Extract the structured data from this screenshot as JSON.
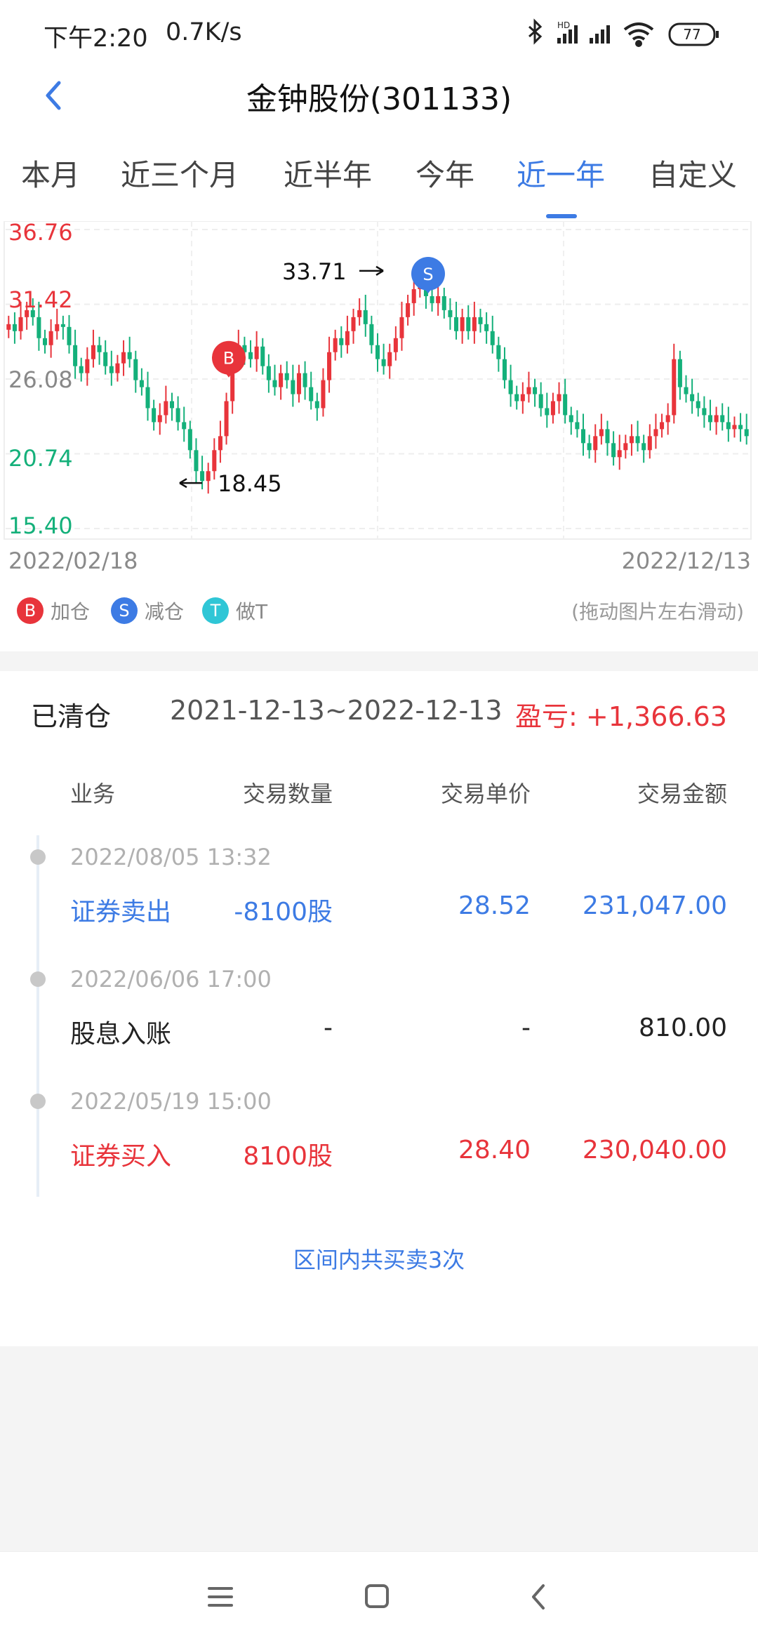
{
  "status_bar": {
    "time": "下午2:20",
    "speed": "0.7K/s",
    "battery": "77"
  },
  "header": {
    "title": "金钟股份(301133)"
  },
  "tabs": [
    {
      "label": "本月",
      "active": false
    },
    {
      "label": "近三个月",
      "active": false
    },
    {
      "label": "近半年",
      "active": false
    },
    {
      "label": "今年",
      "active": false
    },
    {
      "label": "近一年",
      "active": true
    },
    {
      "label": "自定义",
      "active": false
    }
  ],
  "chart": {
    "y_ticks": [
      "36.76",
      "31.42",
      "26.08",
      "20.74",
      "15.40"
    ],
    "start_date": "2022/02/18",
    "end_date": "2022/12/13",
    "high_label": "33.71",
    "low_label": "18.45",
    "buy_marker": "B",
    "sell_marker": "S"
  },
  "chart_data": {
    "type": "candlestick",
    "ylim": [
      15.4,
      36.76
    ],
    "y_ticks": [
      36.76,
      31.42,
      26.08,
      20.74,
      15.4
    ],
    "x_range": [
      "2022/02/18",
      "2022/12/13"
    ],
    "close": [
      30.0,
      29.5,
      30.5,
      31.0,
      30.5,
      29.0,
      28.5,
      29.5,
      30.0,
      29.8,
      28.5,
      27.0,
      26.5,
      27.5,
      28.5,
      28.0,
      27.0,
      26.5,
      27.2,
      28.0,
      27.5,
      26.0,
      25.5,
      24.0,
      23.0,
      23.5,
      24.5,
      24.0,
      23.0,
      22.5,
      21.0,
      19.5,
      18.8,
      19.5,
      21.0,
      22.0,
      24.5,
      27.5,
      28.5,
      28.0,
      27.5,
      28.4,
      27.0,
      26.0,
      25.5,
      26.5,
      26.0,
      25.0,
      26.5,
      25.5,
      24.5,
      24.0,
      26.0,
      28.0,
      29.0,
      28.5,
      29.5,
      30.5,
      31.0,
      30.0,
      28.5,
      27.5,
      27.0,
      28.0,
      29.0,
      30.5,
      31.5,
      32.5,
      33.0,
      32.0,
      31.5,
      32.0,
      31.0,
      30.5,
      29.5,
      30.5,
      29.5,
      30.5,
      30.0,
      29.5,
      28.5,
      27.5,
      26.0,
      25.0,
      24.5,
      25.0,
      25.5,
      25.0,
      24.0,
      23.5,
      24.5,
      25.0,
      23.5,
      23.0,
      22.5,
      21.5,
      21.0,
      22.0,
      22.5,
      21.5,
      20.5,
      21.0,
      21.5,
      22.0,
      21.5,
      21.0,
      22.0,
      22.5,
      23.0,
      23.5,
      27.5,
      25.5,
      25.0,
      24.5,
      24.0,
      23.5,
      23.0,
      23.5,
      23.0,
      22.5,
      22.8,
      22.5,
      22.0
    ],
    "high_point": {
      "value": 33.71
    },
    "low_point": {
      "value": 18.45
    },
    "markers": [
      {
        "label": "B",
        "meaning": "加仓"
      },
      {
        "label": "S",
        "meaning": "减仓"
      }
    ],
    "colors": {
      "up": "#e8343b",
      "down": "#14b07a"
    }
  },
  "legend": {
    "items": [
      {
        "label": "加仓",
        "marker": "B",
        "color": "#e8343b"
      },
      {
        "label": "减仓",
        "marker": "S",
        "color": "#3d7be4"
      },
      {
        "label": "做T",
        "marker": "T",
        "color": "#2fc6d6"
      }
    ],
    "hint": "(拖动图片左右滑动)"
  },
  "summary": {
    "status": "已清仓",
    "range": "2021-12-13~2022-12-13",
    "pnl": "盈亏: +1,366.63"
  },
  "table": {
    "headers": [
      "业务",
      "交易数量",
      "交易单价",
      "交易金额"
    ],
    "rows": [
      {
        "time": "2022/08/05 13:32",
        "type": "证券卖出",
        "qty": "-8100股",
        "price": "28.52",
        "amount": "231,047.00",
        "color": "#3d7be4"
      },
      {
        "time": "2022/06/06 17:00",
        "type": "股息入账",
        "qty": "-",
        "price": "-",
        "amount": "810.00",
        "color": "#222222"
      },
      {
        "time": "2022/05/19 15:00",
        "type": "证券买入",
        "qty": "8100股",
        "price": "28.40",
        "amount": "230,040.00",
        "color": "#e8343b"
      }
    ]
  },
  "footer": {
    "trade_count": "区间内共买卖3次"
  }
}
